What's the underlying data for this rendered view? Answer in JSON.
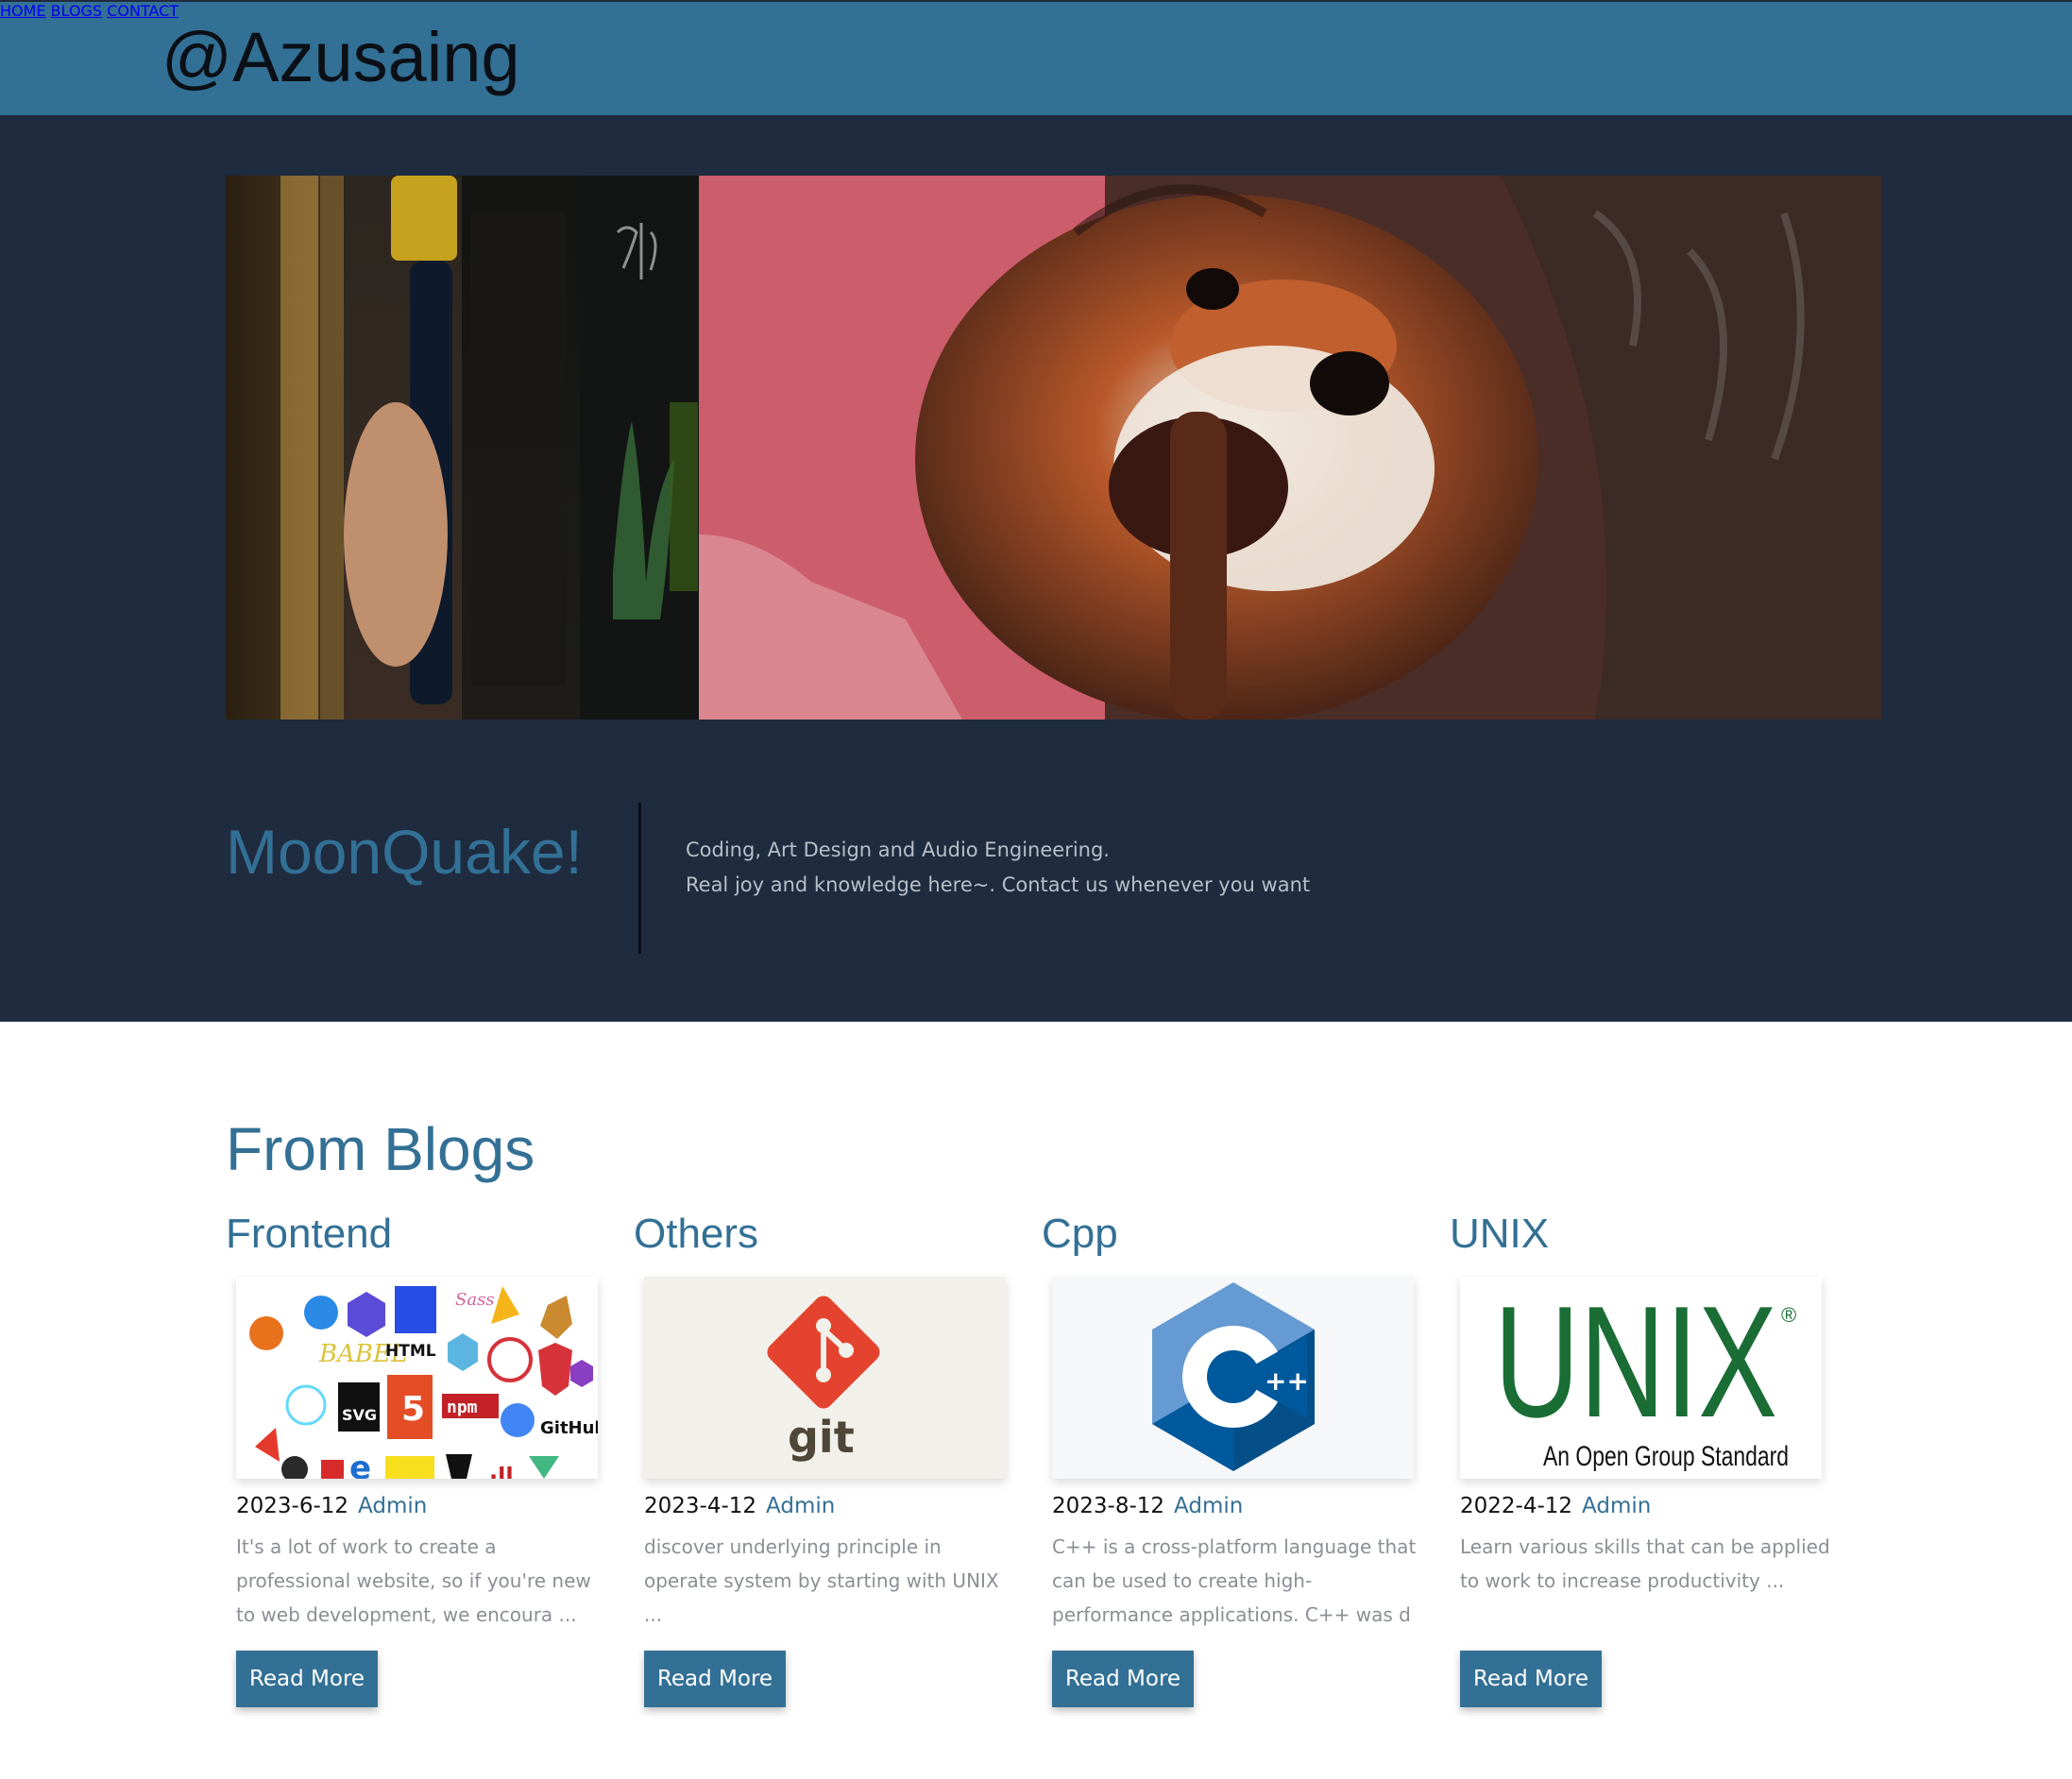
{
  "header": {
    "brand": "@Azusaing",
    "nav": [
      {
        "label": "HOME"
      },
      {
        "label": "BLOGS"
      },
      {
        "label": "CONTACT"
      }
    ]
  },
  "hero": {
    "title": "MoonQuake!",
    "description": [
      "Coding, Art Design and Audio Engineering.",
      "Real joy and knowledge here~. Contact us whenever you want"
    ]
  },
  "blogs": {
    "title": "From Blogs",
    "cards": [
      {
        "category": "Frontend",
        "date": "2023-6-12",
        "author": "Admin",
        "excerpt": "It's a lot of work to create a professional website, so if you're new to web development, we encoura ...",
        "button": "Read More",
        "thumb_labels": [
          "BABEL",
          "HTML",
          "SVG",
          "npm",
          "GitHub"
        ]
      },
      {
        "category": "Others",
        "date": "2023-4-12",
        "author": "Admin",
        "excerpt": "discover underlying principle in operate system by starting with UNIX ...",
        "button": "Read More",
        "thumb_labels": [
          "git"
        ]
      },
      {
        "category": "Cpp",
        "date": "2023-8-12",
        "author": "Admin",
        "excerpt": "C++ is a cross-platform language that can be used to create high-performance applications. C++ was d ...",
        "button": "Read More",
        "thumb_labels": [
          "C",
          "++"
        ]
      },
      {
        "category": "UNIX",
        "date": "2022-4-12",
        "author": "Admin",
        "excerpt": "Learn various skills that can be applied to work to increase productivity ...",
        "button": "Read More",
        "thumb_labels": [
          "UNIX",
          "®",
          "An Open Group Standard"
        ]
      }
    ]
  },
  "colors": {
    "accent": "#337095",
    "hero_bg": "#1f2b3f",
    "text_muted": "#8b8f95"
  }
}
